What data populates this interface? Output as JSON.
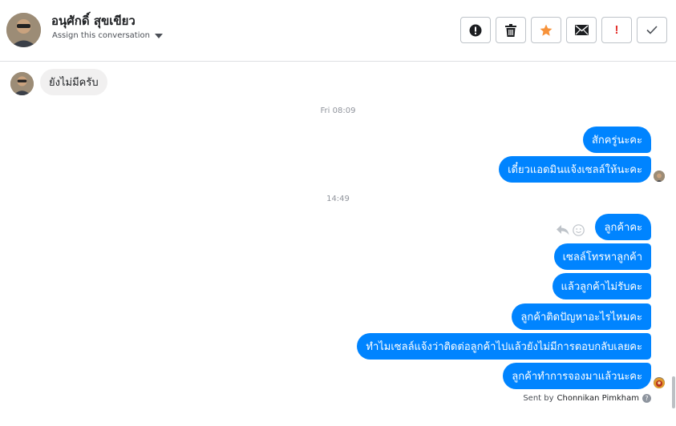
{
  "header": {
    "contact_name": "อนุศักดิ์ สุขเขียว",
    "assign_label": "Assign this conversation",
    "toolbar": [
      {
        "name": "alert-circle-button",
        "icon": "alert-circle-icon"
      },
      {
        "name": "delete-button",
        "icon": "trash-icon"
      },
      {
        "name": "star-button",
        "icon": "star-icon"
      },
      {
        "name": "mark-unread-button",
        "icon": "envelope-icon"
      },
      {
        "name": "spam-button",
        "icon": "exclamation-icon"
      },
      {
        "name": "mark-done-button",
        "icon": "checkmark-icon"
      }
    ]
  },
  "thread": {
    "incoming_message": "ยังไม่มีครับ",
    "timestamp_1": "Fri 08:09",
    "group_1": [
      "สักครู่นะคะ",
      "เดี๋ยวแอดมินแจ้งเซลล์ให้นะคะ"
    ],
    "timestamp_2": "14:49",
    "group_2": [
      "ลูกค้าคะ",
      "เซลล์โทรหาลูกค้า",
      "แล้วลูกค้าไม่รับคะ",
      "ลูกค้าติดปัญหาอะไรไหมคะ",
      "ทำไมเซลล์แจ้งว่าติดต่อลูกค้าไปแล้วยังไม่มีการตอบกลับเลยคะ",
      "ลูกค้าทำการจองมาแล้วนะคะ"
    ],
    "sent_by_prefix": "Sent by",
    "sent_by_name": "Chonnikan Pimkham"
  },
  "colors": {
    "outgoing_bubble": "#0084ff",
    "incoming_bubble": "#f1f0f0",
    "star": "#f7923a",
    "spam": "#e4312c"
  }
}
